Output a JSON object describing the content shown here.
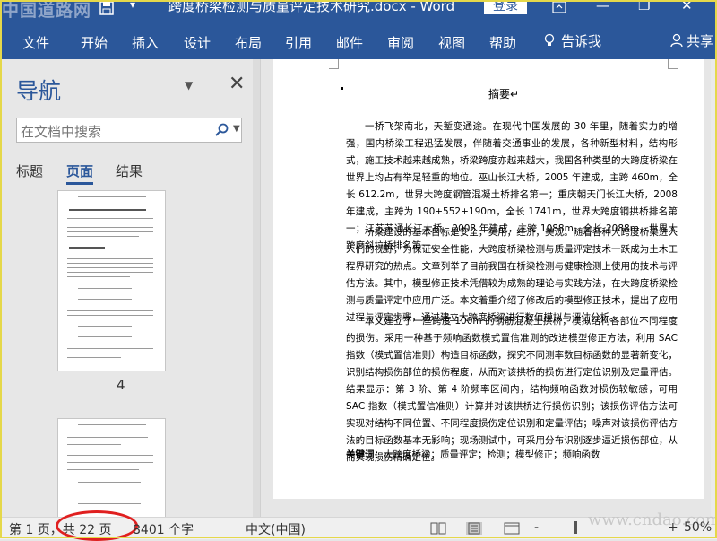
{
  "titlebar": {
    "watermark": "中国道路网",
    "doc_title": "跨度桥梁检测与质量评定技术研究.docx - Word",
    "login_label": "登录",
    "restore": "❐",
    "minimize": "—",
    "maximize": "□"
  },
  "ribbon": {
    "tabs": [
      "文件",
      "开始",
      "插入",
      "设计",
      "布局",
      "引用",
      "邮件",
      "审阅",
      "视图",
      "帮助"
    ],
    "tell_me": "告诉我",
    "share": "共享"
  },
  "nav": {
    "title": "导航",
    "search_placeholder": "在文档中搜索",
    "tabs": [
      "标题",
      "页面",
      "结果"
    ],
    "active_tab": "页面",
    "page_label": "4"
  },
  "document": {
    "heading": "摘要",
    "paragraphs": [
      "一桥飞架南北，天堑变通途。在现代中国发展的 30 年里，随着实力的增强，国内桥梁工程迅猛发展，伴随着交通事业的发展，各种新型材料，结构形式，施工技术越来越成熟，桥梁跨度亦越来越大，我国各种类型的大跨度桥梁在世界上均占有举足轻重的地位。巫山长江大桥，2005 年建成，主跨 460m，全长 612.2m，世界大跨度钢管混凝土桥排名第一；重庆朝天门长江大桥，2008 年建成，主跨为 190+552+190m，全长 1741m，世界大跨度钢拱桥排名第一；江苏苏通长江大桥，2008 年建成，主跨 1088m，全长 2088m，世界大跨度斜拉桥排名第一。",
      "桥梁建设的基本目标是安全，实用，经济，美观。随着各种大跨度桥梁进入人们的视野，为保证安全性能，大跨度桥梁检测与质量评定技术一跃成为土木工程界研究的热点。文章列举了目前我国在桥梁检测与健康检测上使用的技术与评估方法。其中，模型修正技术凭借较为成熟的理论与实践方法，在大跨度桥梁检测与质量评定中应用广泛。本文着重介绍了修改后的模型修正技术，提出了应用过程与评定步骤，通过建立大跨度桥梁进行数值模拟与评估分析。",
      "本文建立了一座跨度 100m 的钢筋混凝土拱桥，模拟结构各部位不同程度的损伤。采用一种基于频响函数模式置信准则的改进模型修正方法，利用 SAC 指数（模式置信准则）构造目标函数，探究不同测率数目标函数的显著新变化，识别结构损伤部位的损伤程度，从而对该拱桥的损伤进行定位识别及定量评估。结果显示：第 3 阶、第 4 阶频率区间内，结构频响函数对损伤较敏感，可用 SAC 指数（模式置信准则）计算并对该拱桥进行损伤识别；该损伤评估方法可实现对结构不同位置、不同程度损伤定位识别和定量评估；噪声对该损伤评估方法的目标函数基本无影响；现场测试中，可采用分布识别逐步逼近损伤部位，从而实现损伤精确定位。"
    ],
    "keywords_label": "关键词：",
    "keywords": "大跨度桥梁；质量评定；检测；模型修正；频响函数"
  },
  "status": {
    "page_info": "第 1 页，共 22 页",
    "word_count": "8401 个字",
    "language": "中文(中国)",
    "zoom_minus": "-",
    "zoom_plus": "+",
    "zoom": "50%",
    "watermark": "www.cndao.com"
  },
  "colors": {
    "ribbon_blue": "#2b579a",
    "highlight_ellipse": "#e02020"
  }
}
